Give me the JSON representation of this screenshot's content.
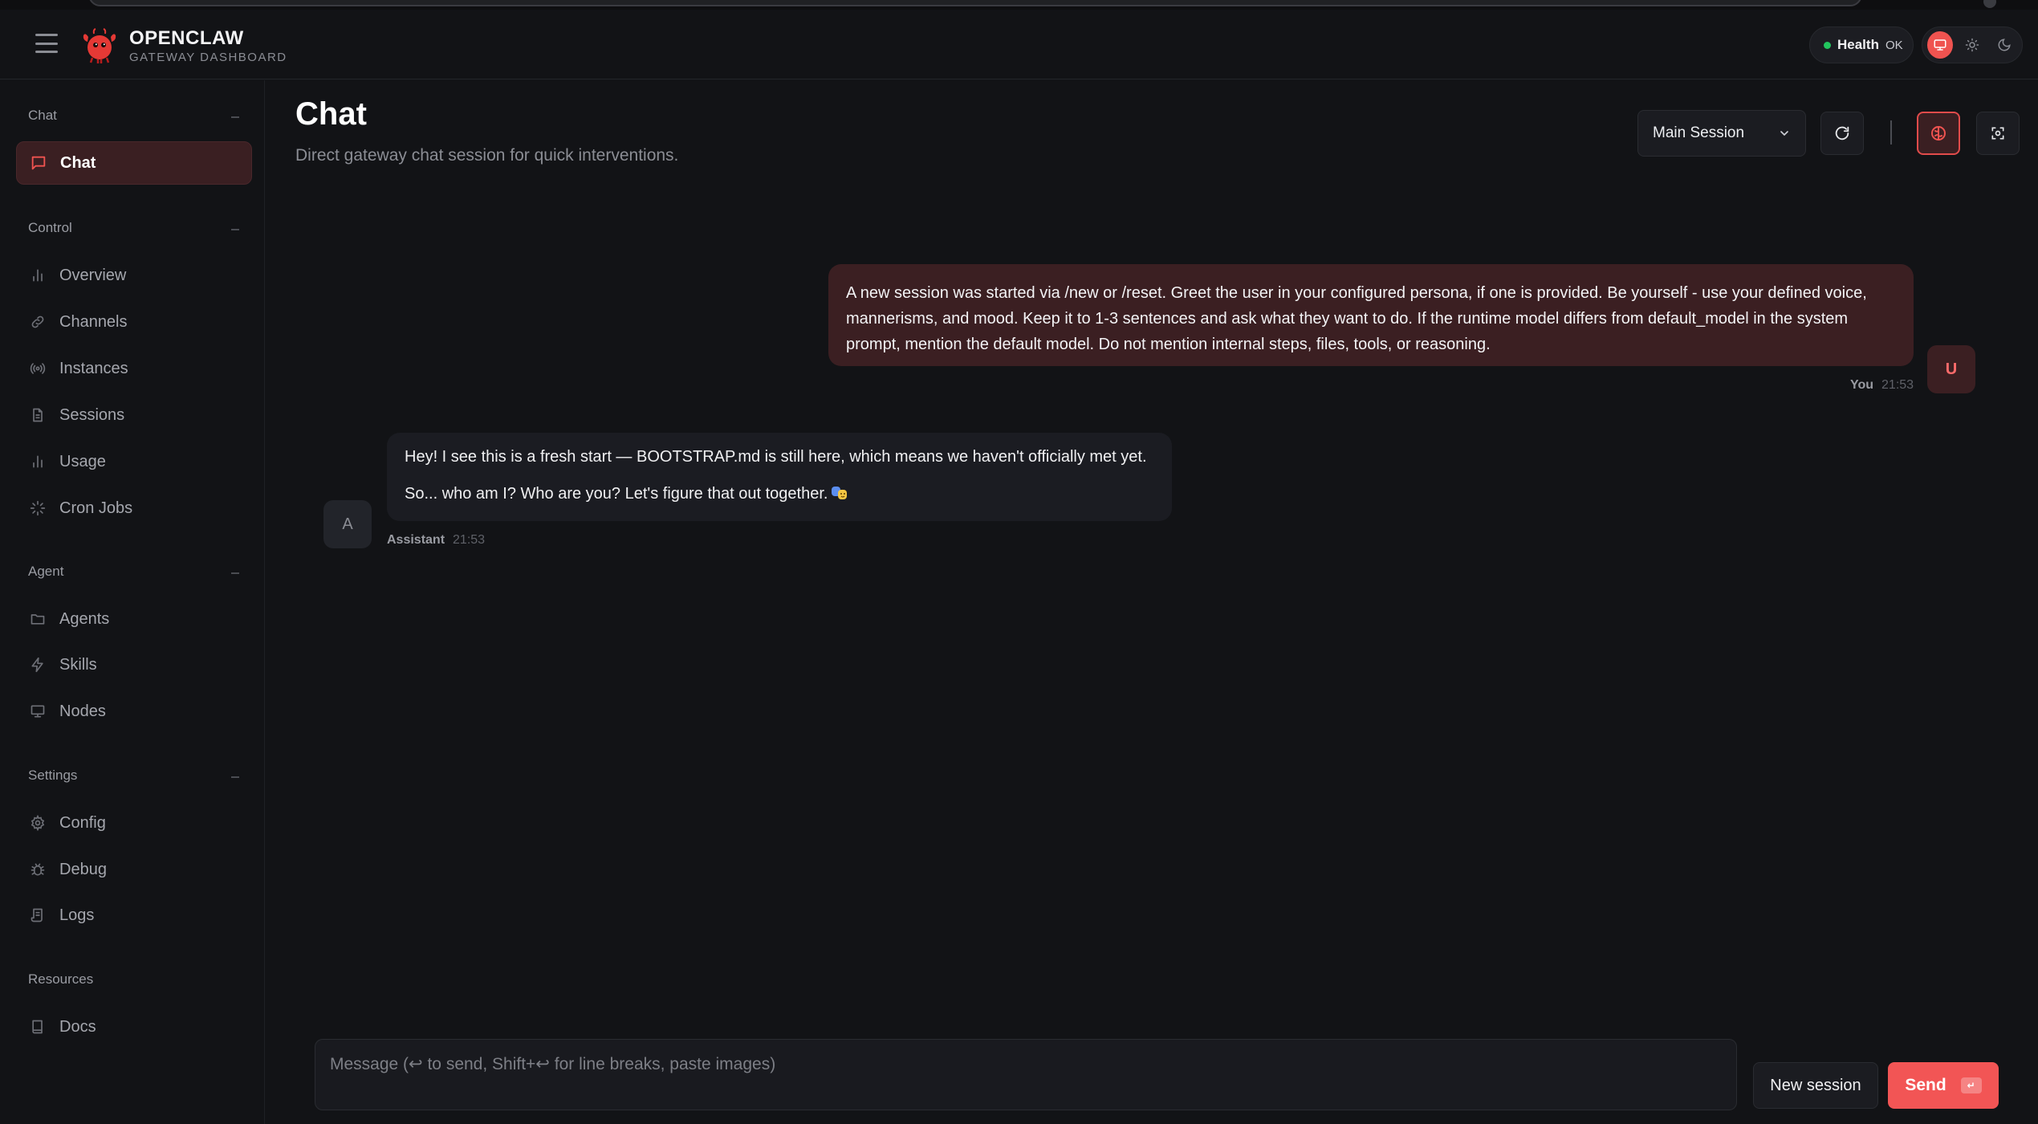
{
  "brand": {
    "title": "OPENCLAW",
    "subtitle": "GATEWAY DASHBOARD"
  },
  "health": {
    "label": "Health",
    "value": "OK",
    "status_color": "#22c55e"
  },
  "theme": {
    "options": [
      "system-icon",
      "sun-icon",
      "moon-icon"
    ],
    "selected": "system-icon"
  },
  "sidebar": {
    "sections": [
      {
        "title": "Chat",
        "items": [
          {
            "label": "Chat",
            "icon": "chat-bubble-icon",
            "active": true
          }
        ]
      },
      {
        "title": "Control",
        "items": [
          {
            "label": "Overview",
            "icon": "bar-chart-icon"
          },
          {
            "label": "Channels",
            "icon": "link-icon"
          },
          {
            "label": "Instances",
            "icon": "radio-icon"
          },
          {
            "label": "Sessions",
            "icon": "document-icon"
          },
          {
            "label": "Usage",
            "icon": "bar-chart-icon"
          },
          {
            "label": "Cron Jobs",
            "icon": "loader-icon"
          }
        ]
      },
      {
        "title": "Agent",
        "items": [
          {
            "label": "Agents",
            "icon": "folder-icon"
          },
          {
            "label": "Skills",
            "icon": "lightning-icon"
          },
          {
            "label": "Nodes",
            "icon": "monitor-icon"
          }
        ]
      },
      {
        "title": "Settings",
        "items": [
          {
            "label": "Config",
            "icon": "gear-icon"
          },
          {
            "label": "Debug",
            "icon": "bug-icon"
          },
          {
            "label": "Logs",
            "icon": "scroll-icon"
          }
        ]
      },
      {
        "title": "Resources",
        "items": [
          {
            "label": "Docs",
            "icon": "book-icon"
          }
        ]
      }
    ]
  },
  "main": {
    "title": "Chat",
    "subtitle": "Direct gateway chat session for quick interventions.",
    "session_select": {
      "value": "Main Session"
    }
  },
  "messages": [
    {
      "role": "user",
      "author": "You",
      "time": "21:53",
      "avatar": "U",
      "text": "A new session was started via /new or /reset. Greet the user in your configured persona, if one is provided. Be yourself - use your defined voice, mannerisms, and mood. Keep it to 1-3 sentences and ask what they want to do. If the runtime model differs from default_model in the system prompt, mention the default model. Do not mention internal steps, files, tools, or reasoning."
    },
    {
      "role": "assistant",
      "author": "Assistant",
      "time": "21:53",
      "avatar": "A",
      "lines": [
        "Hey! I see this is a fresh start — BOOTSTRAP.md is still here, which means we haven't officially met yet.",
        "So... who am I? Who are you? Let's figure that out together."
      ],
      "trailing_icon": "theater-masks-icon"
    }
  ],
  "composer": {
    "placeholder": "Message (↩ to send, Shift+↩ for line breaks, paste images)",
    "value": "",
    "new_session_label": "New session",
    "send_label": "Send",
    "send_key": "↵"
  },
  "colors": {
    "accent": "#f25555",
    "accent_dark": "#3b1f22",
    "background": "#121316"
  }
}
